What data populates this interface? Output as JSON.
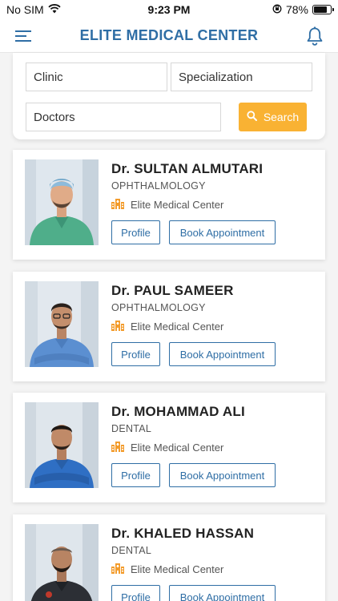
{
  "status_bar": {
    "carrier": "No SIM",
    "time": "9:23 PM",
    "battery": "78%",
    "battery_level": 0.78
  },
  "header": {
    "title": "ELITE MEDICAL CENTER",
    "menu_icon": "hamburger-menu-icon",
    "notification_icon": "bell-icon"
  },
  "search": {
    "clinic_label": "Clinic",
    "specialization_label": "Specialization",
    "doctors_label": "Doctors",
    "button_label": "Search",
    "button_color": "#f9b233"
  },
  "colors": {
    "accent": "#2f6ea5",
    "clinic_icon": "#f39c2c"
  },
  "doctors": [
    {
      "name": "Dr. SULTAN ALMUTARI",
      "specialization": "OPHTHALMOLOGY",
      "clinic": "Elite Medical Center",
      "profile_label": "Profile",
      "book_label": "Book Appointment"
    },
    {
      "name": "Dr. PAUL SAMEER",
      "specialization": "OPHTHALMOLOGY",
      "clinic": "Elite Medical Center",
      "profile_label": "Profile",
      "book_label": "Book Appointment"
    },
    {
      "name": "Dr. MOHAMMAD ALI",
      "specialization": "DENTAL",
      "clinic": "Elite Medical Center",
      "profile_label": "Profile",
      "book_label": "Book Appointment"
    },
    {
      "name": "Dr. KHALED HASSAN",
      "specialization": "DENTAL",
      "clinic": "Elite Medical Center",
      "profile_label": "Profile",
      "book_label": "Book Appointment"
    }
  ]
}
